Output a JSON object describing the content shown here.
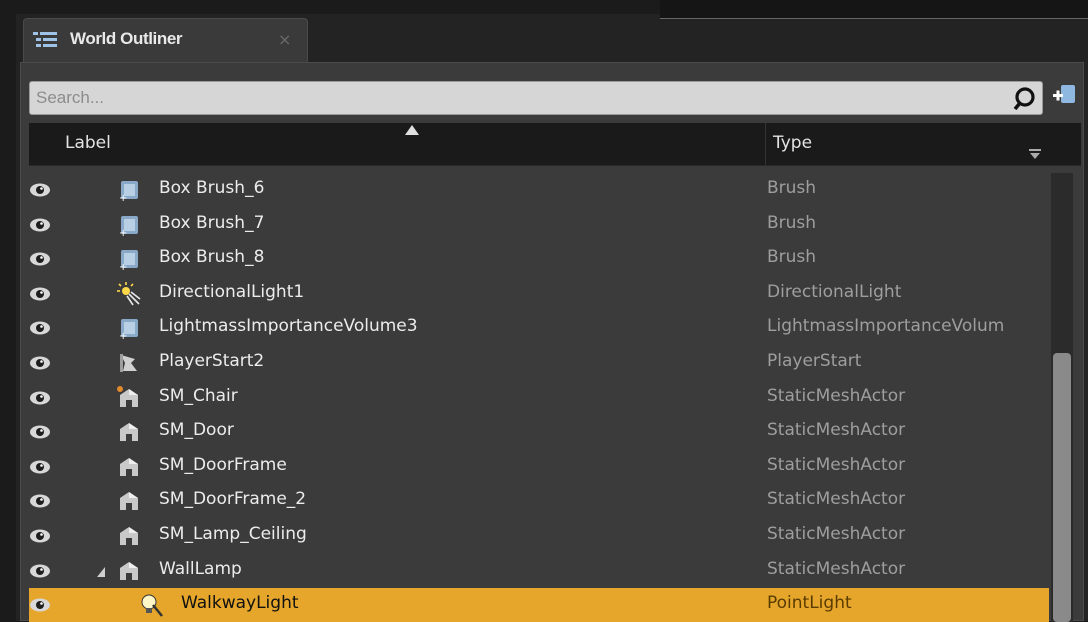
{
  "tab": {
    "title": "World Outliner",
    "close": "×",
    "icon": "list-icon"
  },
  "search": {
    "placeholder": "Search...",
    "value": ""
  },
  "columns": {
    "label": "Label",
    "type": "Type"
  },
  "rows": [
    {
      "label": "Box Brush_6",
      "type": "Brush",
      "icon": "brush-icon"
    },
    {
      "label": "Box Brush_7",
      "type": "Brush",
      "icon": "brush-icon"
    },
    {
      "label": "Box Brush_8",
      "type": "Brush",
      "icon": "brush-icon"
    },
    {
      "label": "DirectionalLight1",
      "type": "DirectionalLight",
      "icon": "directional-light-icon"
    },
    {
      "label": "LightmassImportanceVolume3",
      "type": "LightmassImportanceVolum",
      "icon": "volume-icon"
    },
    {
      "label": "PlayerStart2",
      "type": "PlayerStart",
      "icon": "player-start-icon"
    },
    {
      "label": "SM_Chair",
      "type": "StaticMeshActor",
      "icon": "static-mesh-icon"
    },
    {
      "label": "SM_Door",
      "type": "StaticMeshActor",
      "icon": "static-mesh-icon"
    },
    {
      "label": "SM_DoorFrame",
      "type": "StaticMeshActor",
      "icon": "static-mesh-icon"
    },
    {
      "label": "SM_DoorFrame_2",
      "type": "StaticMeshActor",
      "icon": "static-mesh-icon"
    },
    {
      "label": "SM_Lamp_Ceiling",
      "type": "StaticMeshActor",
      "icon": "static-mesh-icon"
    },
    {
      "label": "WallLamp",
      "type": "StaticMeshActor",
      "icon": "static-mesh-icon"
    },
    {
      "label": "WalkwayLight",
      "type": "PointLight",
      "icon": "point-light-icon"
    }
  ],
  "colors": {
    "selection": "#e5a62b",
    "panel": "#3b3b3b",
    "header": "#1a1a1a"
  }
}
